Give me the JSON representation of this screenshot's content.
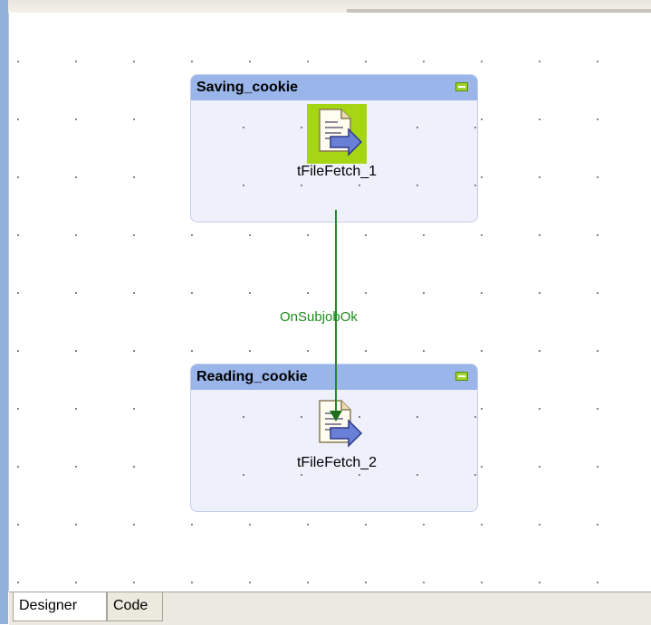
{
  "subjobs": [
    {
      "title": "Saving_cookie",
      "component": {
        "label": "tFileFetch_1"
      }
    },
    {
      "title": "Reading_cookie",
      "component": {
        "label": "tFileFetch_2"
      }
    }
  ],
  "link": {
    "label": "OnSubjobOk",
    "color": "#1f8a1f"
  },
  "tabs": [
    {
      "label": "Designer",
      "active": true
    },
    {
      "label": "Code",
      "active": false
    }
  ],
  "colors": {
    "subjob_header": "#9ab5ea",
    "subjob_body": "#eef0fb",
    "selection": "#a6d514"
  }
}
